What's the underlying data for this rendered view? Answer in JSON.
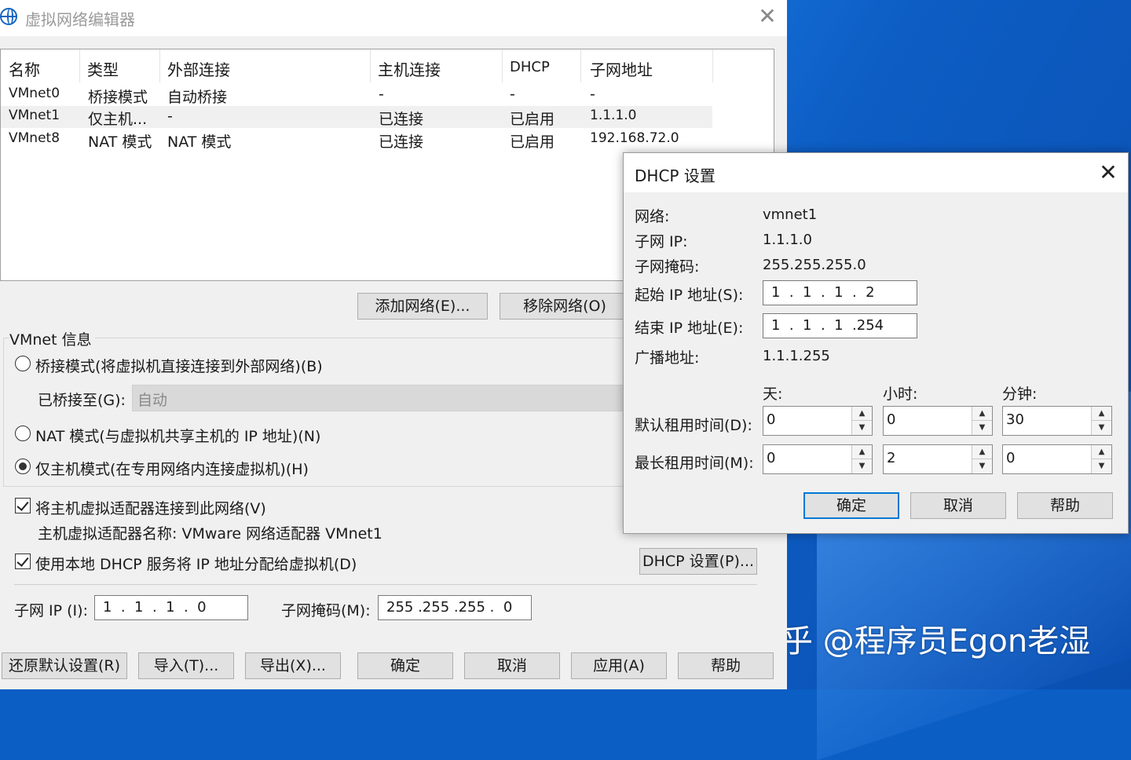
{
  "main_window": {
    "title": "虚拟网络编辑器",
    "columns": [
      "名称",
      "类型",
      "外部连接",
      "主机连接",
      "DHCP",
      "子网地址"
    ],
    "rows": [
      {
        "name": "VMnet0",
        "type": "桥接模式",
        "external": "自动桥接",
        "host": "-",
        "dhcp": "-",
        "subnet": "-"
      },
      {
        "name": "VMnet1",
        "type": "仅主机...",
        "external": "-",
        "host": "已连接",
        "dhcp": "已启用",
        "subnet": "1.1.1.0"
      },
      {
        "name": "VMnet8",
        "type": "NAT 模式",
        "external": "NAT 模式",
        "host": "已连接",
        "dhcp": "已启用",
        "subnet": "192.168.72.0"
      }
    ],
    "add_network_label": "添加网络(E)...",
    "remove_network_label": "移除网络(O)",
    "vmnet_info_label": "VMnet 信息",
    "bridged_option": "桥接模式(将虚拟机直接连接到外部网络)(B)",
    "bridged_to_label": "已桥接至(G):",
    "bridged_to_value": "自动",
    "nat_option": "NAT 模式(与虚拟机共享主机的 IP 地址)(N)",
    "hostonly_option": "仅主机模式(在专用网络内连接虚拟机)(H)",
    "connect_adapter_label": "将主机虚拟适配器连接到此网络(V)",
    "adapter_name_label": "主机虚拟适配器名称: VMware 网络适配器 VMnet1",
    "use_dhcp_label": "使用本地 DHCP 服务将 IP 地址分配给虚拟机(D)",
    "dhcp_settings_label": "DHCP 设置(P)...",
    "subnet_ip_label": "子网 IP (I):",
    "subnet_ip_value": "1  .  1  .  1  .  0",
    "subnet_mask_label": "子网掩码(M):",
    "subnet_mask_value": "255 .255 .255 .  0",
    "restore_defaults_label": "还原默认设置(R)",
    "import_label": "导入(T)...",
    "export_label": "导出(X)...",
    "ok_label": "确定",
    "cancel_label": "取消",
    "apply_label": "应用(A)",
    "help_label": "帮助"
  },
  "dhcp_dialog": {
    "title": "DHCP 设置",
    "network_label": "网络:",
    "network_value": "vmnet1",
    "subnet_ip_label": "子网 IP:",
    "subnet_ip_value": "1.1.1.0",
    "subnet_mask_label": "子网掩码:",
    "subnet_mask_value": "255.255.255.0",
    "start_ip_label": "起始 IP 地址(S):",
    "start_ip_value": "1  .  1  .  1  .  2",
    "end_ip_label": "结束 IP 地址(E):",
    "end_ip_value": "1  .  1  .  1  .254",
    "broadcast_label": "广播地址:",
    "broadcast_value": "1.1.1.255",
    "days_label": "天:",
    "hours_label": "小时:",
    "minutes_label": "分钟:",
    "default_lease_label": "默认租用时间(D):",
    "max_lease_label": "最长租用时间(M):",
    "default_lease": {
      "days": "0",
      "hours": "0",
      "minutes": "30"
    },
    "max_lease": {
      "days": "0",
      "hours": "2",
      "minutes": "0"
    },
    "ok_label": "确定",
    "cancel_label": "取消",
    "help_label": "帮助"
  },
  "watermark": "知乎 @程序员Egon老湿"
}
